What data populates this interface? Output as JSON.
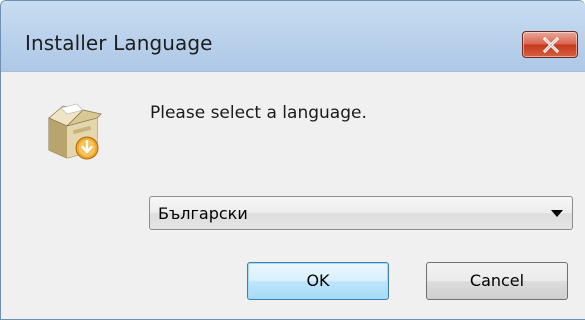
{
  "window": {
    "title": "Installer Language",
    "close_icon": "close-icon"
  },
  "dialog": {
    "icon": "installer-box-icon",
    "prompt": "Please select a language.",
    "language_select": {
      "selected": "Български",
      "arrow_icon": "dropdown-arrow-icon"
    },
    "ok_label": "OK",
    "cancel_label": "Cancel"
  },
  "colors": {
    "titlebar": "#bcd3ec",
    "close_button": "#c4391f",
    "client_bg": "#f0f0f0",
    "default_button_border": "#3c7fb1"
  }
}
